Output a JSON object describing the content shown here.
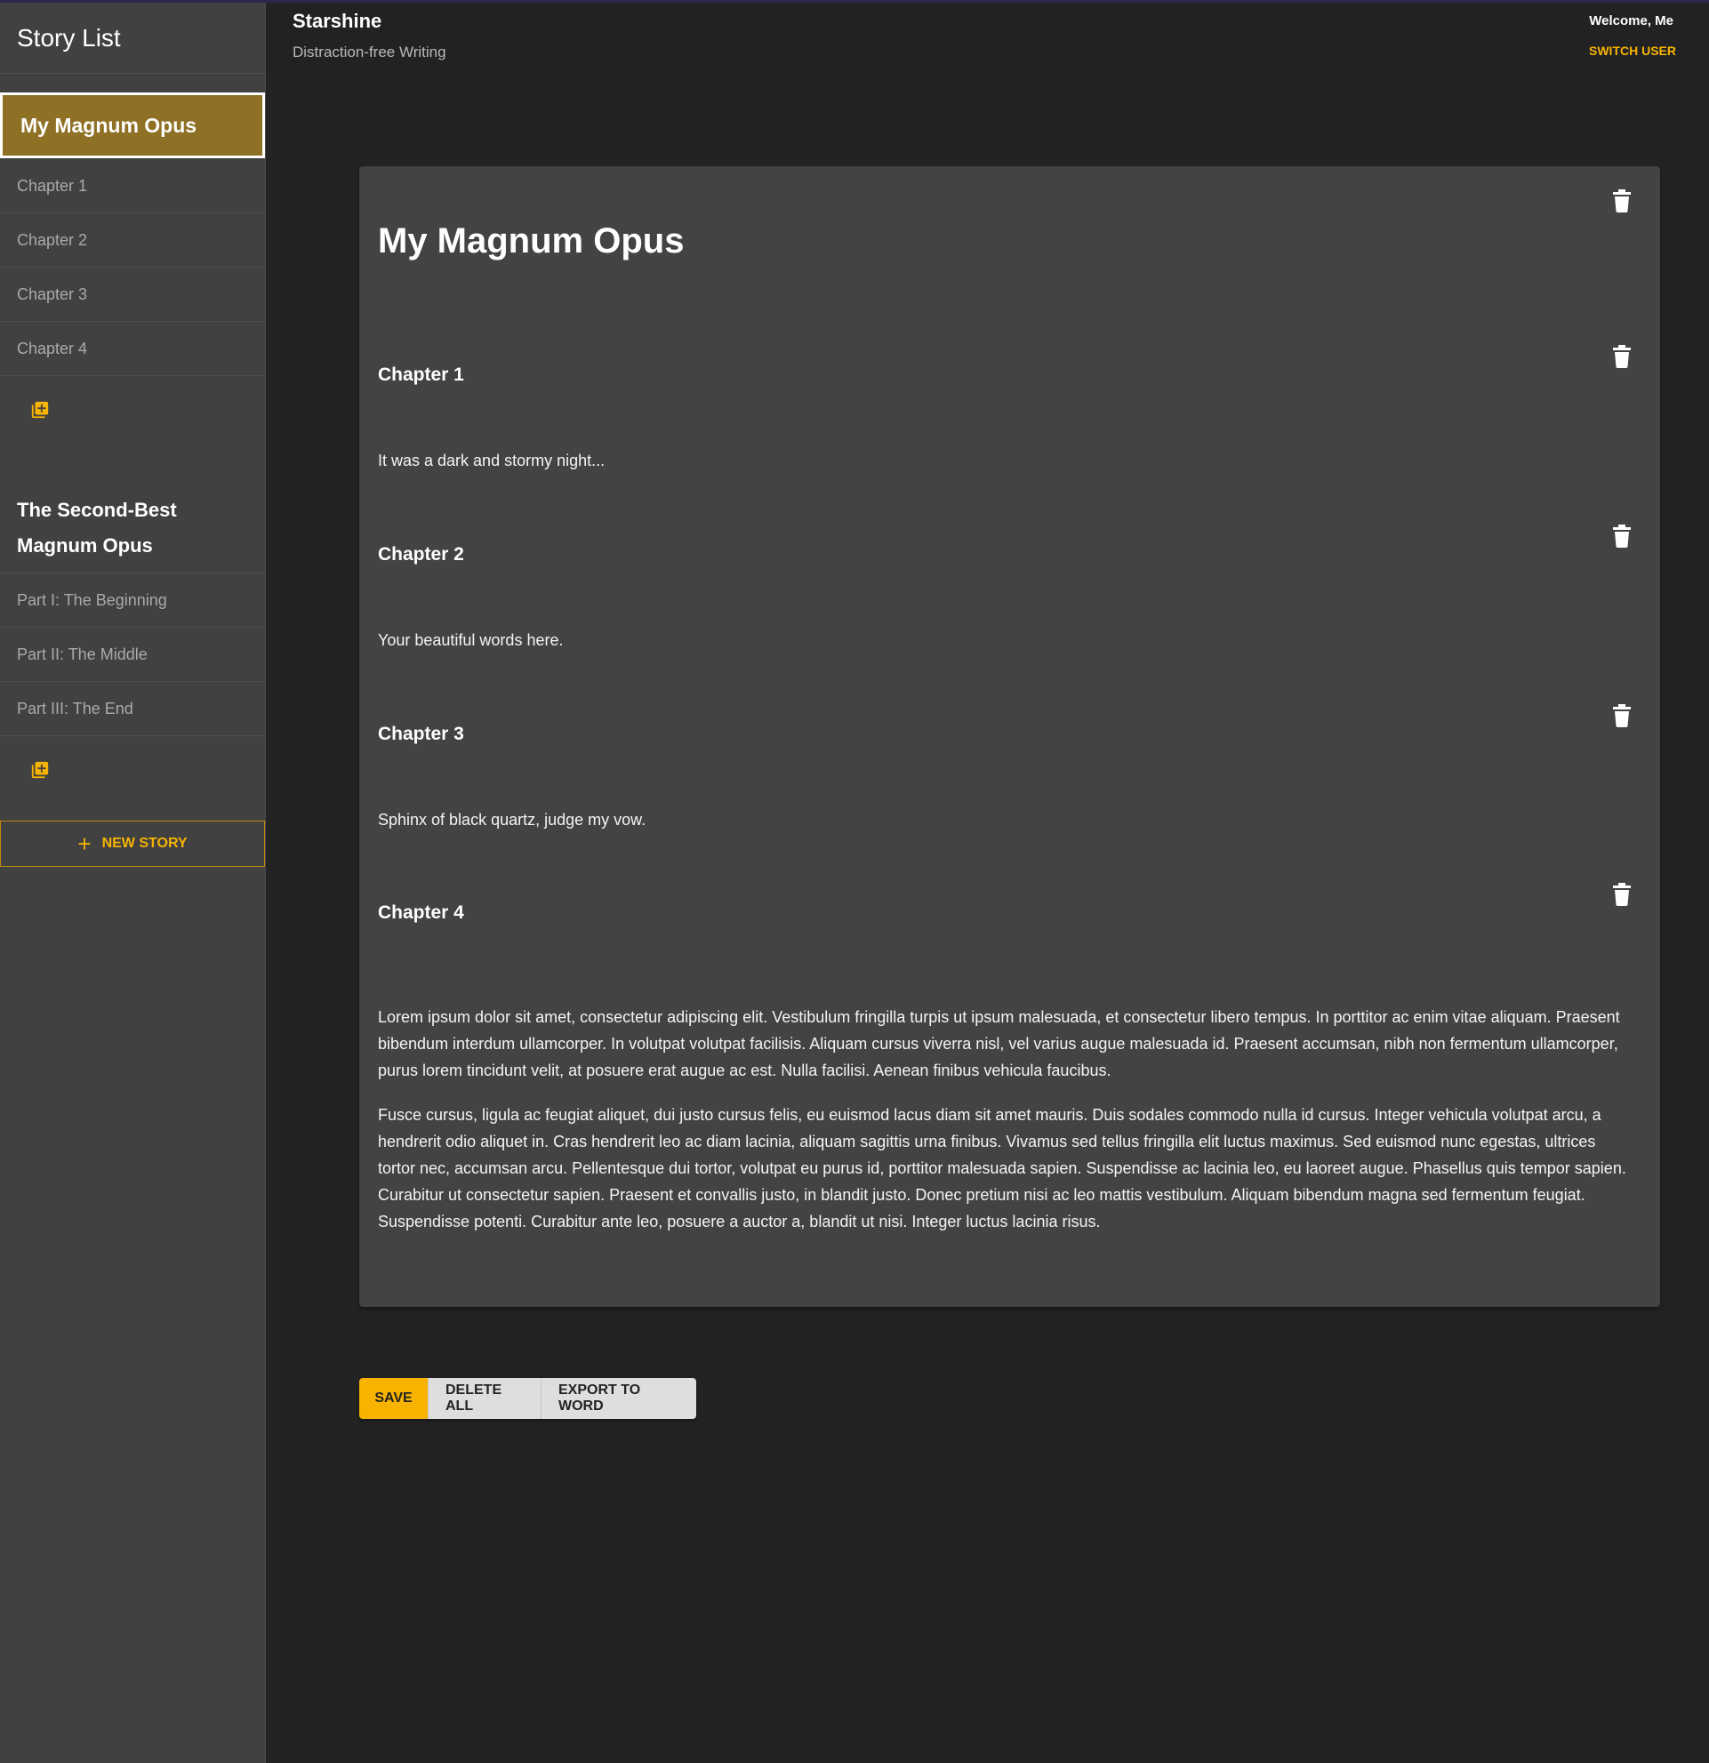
{
  "sidebar": {
    "title": "Story List",
    "stories": [
      {
        "title": "My Magnum Opus",
        "active": true,
        "chapters": [
          "Chapter 1",
          "Chapter 2",
          "Chapter 3",
          "Chapter 4"
        ]
      },
      {
        "title": "The Second-Best Magnum Opus",
        "title_lines": [
          "The Second-Best",
          "Magnum Opus"
        ],
        "active": false,
        "chapters": [
          "Part I: The Beginning",
          "Part II: The Middle",
          "Part III: The End"
        ]
      }
    ],
    "new_story_label": "NEW STORY"
  },
  "header": {
    "app_name": "Starshine",
    "tagline": "Distraction-free Writing",
    "welcome": "Welcome, Me",
    "switch_user": "SWITCH USER"
  },
  "editor": {
    "story_title": "My Magnum Opus",
    "chapters": [
      {
        "title": "Chapter 1",
        "paragraphs": [
          "It was a dark and stormy night..."
        ]
      },
      {
        "title": "Chapter 2",
        "paragraphs": [
          "Your beautiful words here."
        ]
      },
      {
        "title": "Chapter 3",
        "paragraphs": [
          "Sphinx of black quartz, judge my vow."
        ]
      },
      {
        "title": "Chapter 4",
        "paragraphs": [
          "Lorem ipsum dolor sit amet, consectetur adipiscing elit. Vestibulum fringilla turpis ut ipsum malesuada, et consectetur libero tempus. In porttitor ac enim vitae aliquam. Praesent bibendum interdum ullamcorper. In volutpat volutpat facilisis. Aliquam cursus viverra nisl, vel varius augue malesuada id. Praesent accumsan, nibh non fermentum ullamcorper, purus lorem tincidunt velit, at posuere erat augue ac est. Nulla facilisi. Aenean finibus vehicula faucibus.",
          "Fusce cursus, ligula ac feugiat aliquet, dui justo cursus felis, eu euismod lacus diam sit amet mauris. Duis sodales commodo nulla id cursus. Integer vehicula volutpat arcu, a hendrerit odio aliquet in. Cras hendrerit leo ac diam lacinia, aliquam sagittis urna finibus. Vivamus sed tellus fringilla elit luctus maximus. Sed euismod nunc egestas, ultrices tortor nec, accumsan arcu. Pellentesque dui tortor, volutpat eu purus id, porttitor malesuada sapien. Suspendisse ac lacinia leo, eu laoreet augue. Phasellus quis tempor sapien. Curabitur ut consectetur sapien. Praesent et convallis justo, in blandit justo. Donec pretium nisi ac leo mattis vestibulum. Aliquam bibendum magna sed fermentum feugiat. Suspendisse potenti. Curabitur ante leo, posuere a auctor a, blandit ut nisi. Integer luctus lacinia risus."
        ]
      }
    ]
  },
  "actions": {
    "save": "SAVE",
    "delete_all": "DELETE ALL",
    "export": "EXPORT TO WORD"
  },
  "colors": {
    "accent": "#f6b300",
    "active_story_bg": "#8f7125",
    "sidebar_bg": "#414142",
    "page_bg": "#232324",
    "card_bg": "#434344"
  },
  "icons": {
    "delete": "trash-icon",
    "add_chapter": "library-add-icon",
    "new_story": "plus-icon"
  }
}
